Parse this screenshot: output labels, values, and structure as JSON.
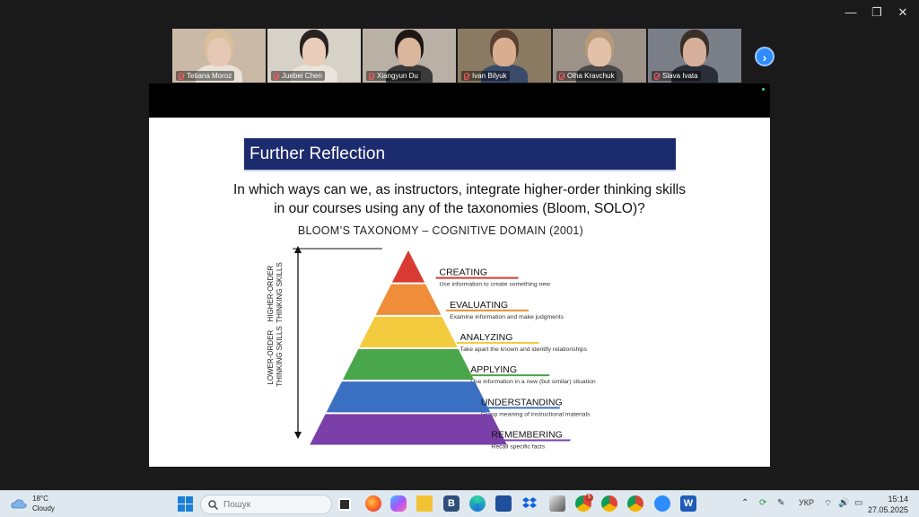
{
  "window_controls": {
    "minimize": "—",
    "restore": "❐",
    "close": "✕"
  },
  "participants": [
    {
      "name": "Tetiana Moroz",
      "muted": true,
      "active": false,
      "bg": "#c9b9a6",
      "skin": "#e6c7b4",
      "hair": "#d8c09a",
      "shirt": "#e8e2d8"
    },
    {
      "name": "Juebei Chen",
      "muted": true,
      "active": true,
      "bg": "#d7d2c8",
      "skin": "#e9cdb8",
      "hair": "#2a2220",
      "shirt": "#e9e4dc"
    },
    {
      "name": "Xiangyun Du",
      "muted": true,
      "active": false,
      "bg": "#b9b1a6",
      "skin": "#d9b69c",
      "hair": "#1e1612",
      "shirt": "#3a3a3a"
    },
    {
      "name": "Ivan Bilyuk",
      "muted": true,
      "active": false,
      "bg": "#8a7a62",
      "skin": "#d8ad90",
      "hair": "#5a4030",
      "shirt": "#3a4a6a"
    },
    {
      "name": "Olha Kravchuk",
      "muted": true,
      "active": false,
      "bg": "#9d9288",
      "skin": "#e2c1a8",
      "hair": "#b79a78",
      "shirt": "#4a4a4a"
    },
    {
      "name": "Slava Ivata",
      "muted": true,
      "active": false,
      "bg": "#7a7e86",
      "skin": "#d6b09a",
      "hair": "#3a3028",
      "shirt": "#2a2e38"
    }
  ],
  "slide": {
    "title": "Further Reflection",
    "question": "In which ways can we, as instructors, integrate higher-order thinking skills in our courses using any of the taxonomies (Bloom, SOLO)?",
    "bloom_title": "BLOOM’S TAXONOMY – COGNITIVE DOMAIN (2001)",
    "higher_label": [
      "HIGHER-ORDER",
      "THINKING SKILLS"
    ],
    "lower_label": [
      "LOWER-ORDER",
      "THINKING SKILLS"
    ],
    "levels": [
      {
        "name": "CREATING",
        "desc": "Use information to create something new",
        "color": "#d93b32"
      },
      {
        "name": "EVALUATING",
        "desc": "Examine information and make judgments",
        "color": "#ef8d3a"
      },
      {
        "name": "ANALYZING",
        "desc": "Take apart the known and identify relationships",
        "color": "#f2cc3e"
      },
      {
        "name": "APPLYING",
        "desc": "Use information in a new (but similar) situation",
        "color": "#4aa64a"
      },
      {
        "name": "UNDERSTANDING",
        "desc": "Grasp meaning of instructional materials",
        "color": "#3b6fc2"
      },
      {
        "name": "REMEMBERING",
        "desc": "Recall specific facts",
        "color": "#7a3fa8"
      }
    ]
  },
  "taskbar": {
    "weather_temp": "18°C",
    "weather_desc": "Cloudy",
    "search_placeholder": "Пошук",
    "language": "УКР",
    "time": "15:14",
    "date": "27.05.2025",
    "badge_count": "5",
    "b_app_letter": "B",
    "word_letter": "W"
  }
}
